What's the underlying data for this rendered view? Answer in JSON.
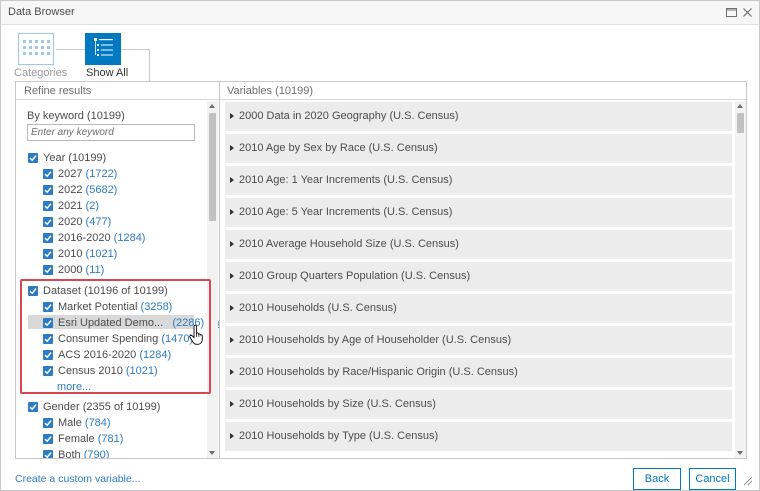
{
  "window": {
    "title": "Data Browser",
    "maximize_icon": "maximize-icon",
    "close_icon": "close-icon"
  },
  "view_tabs": [
    {
      "label": "Categories",
      "icon": "grid-icon",
      "active": false
    },
    {
      "label": "Show All",
      "icon": "list-icon",
      "active": true
    }
  ],
  "left": {
    "header": "Refine results",
    "keyword_label": "By keyword (10199)",
    "keyword_placeholder": "Enter any keyword",
    "year": {
      "label": "Year",
      "count": "(10199)",
      "items": [
        {
          "label": "2027",
          "count": "(1722)"
        },
        {
          "label": "2022",
          "count": "(5682)"
        },
        {
          "label": "2021",
          "count": "(2)"
        },
        {
          "label": "2020",
          "count": "(477)"
        },
        {
          "label": "2016-2020",
          "count": "(1284)"
        },
        {
          "label": "2010",
          "count": "(1021)"
        },
        {
          "label": "2000",
          "count": "(11)"
        }
      ]
    },
    "dataset": {
      "label": "Dataset",
      "count": "(10196 of 10199)",
      "items": [
        {
          "label": "Market Potential",
          "count": "(3258)"
        },
        {
          "label": "Esri Updated Demo...",
          "count": "(2286)",
          "extra": "only"
        },
        {
          "label": "Consumer Spending",
          "count": "(1470)"
        },
        {
          "label": "ACS 2016-2020",
          "count": "(1284)"
        },
        {
          "label": "Census 2010",
          "count": "(1021)"
        }
      ],
      "more": "more..."
    },
    "gender": {
      "label": "Gender",
      "count": "(2355 of 10199)",
      "items": [
        {
          "label": "Male",
          "count": "(784)"
        },
        {
          "label": "Female",
          "count": "(781)"
        },
        {
          "label": "Both",
          "count": "(790)"
        }
      ]
    }
  },
  "right": {
    "header": "Variables (10199)",
    "variables": [
      "2000 Data in 2020 Geography (U.S. Census)",
      "2010 Age by Sex by Race (U.S. Census)",
      "2010 Age: 1 Year Increments (U.S. Census)",
      "2010 Age: 5 Year Increments (U.S. Census)",
      "2010 Average Household Size (U.S. Census)",
      "2010 Group Quarters Population (U.S. Census)",
      "2010 Households (U.S. Census)",
      "2010 Households by Age of Householder (U.S. Census)",
      "2010 Households by Race/Hispanic Origin (U.S. Census)",
      "2010 Households by Size (U.S. Census)",
      "2010 Households by Type (U.S. Census)"
    ]
  },
  "footer": {
    "create_link": "Create a custom variable...",
    "back": "Back",
    "cancel": "Cancel"
  },
  "colors": {
    "accent": "#0079c1",
    "link": "#2d7cc3",
    "highlight_box": "#d8474f",
    "row_bg": "#ececec"
  }
}
